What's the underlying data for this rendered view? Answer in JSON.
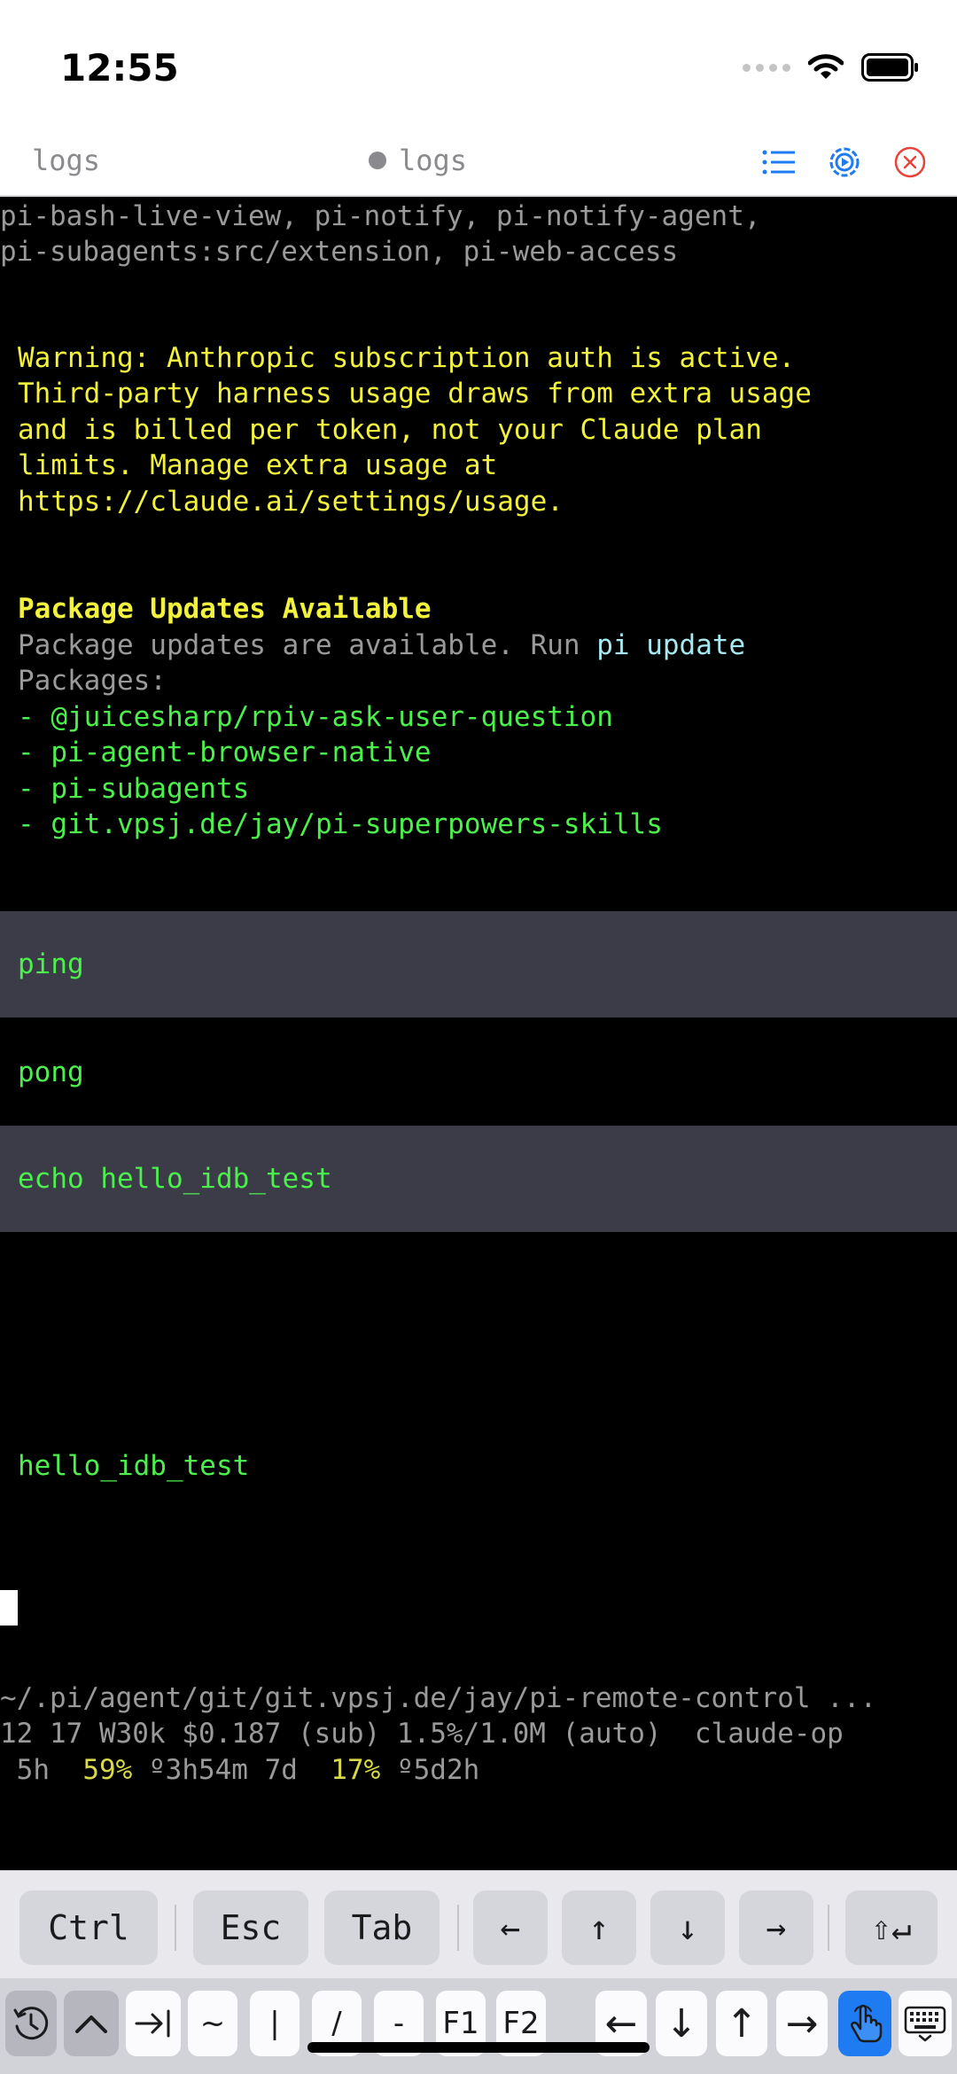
{
  "status_bar": {
    "time": "12:55"
  },
  "tabs": {
    "left_label": "logs",
    "active_label": "logs"
  },
  "terminal": {
    "ext_line_1": "pi-bash-live-view, pi-notify, pi-notify-agent,",
    "ext_line_2": "pi-subagents:src/extension, pi-web-access",
    "warning_lines": [
      "Warning: Anthropic subscription auth is active.",
      "Third-party harness usage draws from extra usage",
      "and is billed per token, not your Claude plan",
      "limits. Manage extra usage at",
      "https://claude.ai/settings/usage."
    ],
    "updates_title": "Package Updates Available",
    "updates_text": "Package updates are available. Run ",
    "updates_cmd": "pi update",
    "packages_label": "Packages:",
    "packages": [
      "- @juicesharp/rpiv-ask-user-question",
      "- pi-agent-browser-native",
      "- pi-subagents",
      "- git.vpsj.de/jay/pi-superpowers-skills"
    ],
    "user_msg_1": "ping",
    "reply_1": "pong",
    "user_msg_2": "echo hello_idb_test",
    "output_1": "hello_idb_test",
    "footer_path": "~/.pi/agent/git/git.vpsj.de/jay/pi-remote-control ...",
    "footer_stats": "12 17 W30k $0.187 (sub) 1.5%/1.0M (auto)  claude-op",
    "usage": {
      "w5": " 5h  ",
      "pct5": "59%",
      "reset5": " º3h54m 7d  ",
      "pct7": "17%",
      "reset7": " º5d2h"
    }
  },
  "keys": {
    "ctrl": "Ctrl",
    "esc": "Esc",
    "tab": "Tab",
    "left": "←",
    "up": "↑",
    "down": "↓",
    "right": "→",
    "enter": "⇧↵"
  },
  "toolbar": {
    "tilde": "~",
    "pipe": "|",
    "slash": "/",
    "dash": "-",
    "f1": "F1",
    "f2": "F2",
    "left": "←",
    "down": "↓",
    "up": "↑",
    "right": "→"
  },
  "colors": {
    "accent": "#1e7bf2",
    "close": "#e8443a",
    "terminal_bg": "#000000",
    "message_band": "#3b3c48",
    "green": "#4cf04c",
    "yellow": "#f2f23d"
  },
  "icons": [
    "wifi-icon",
    "battery-icon",
    "list-icon",
    "settings-icon",
    "close-icon",
    "history-icon",
    "chevron-up-icon",
    "tab-key-icon",
    "hand-pointer-icon",
    "keyboard-icon"
  ]
}
